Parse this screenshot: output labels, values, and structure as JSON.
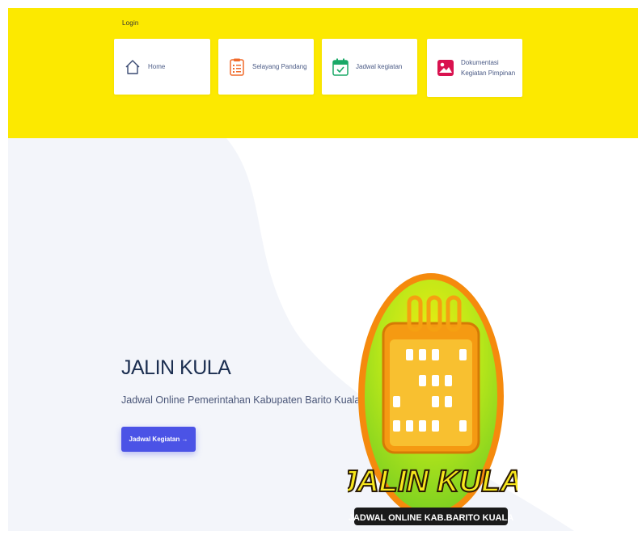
{
  "header": {
    "login_label": "Login",
    "nav": [
      {
        "label": "Home",
        "icon": "home-icon"
      },
      {
        "label": "Selayang Pandang",
        "icon": "clipboard-list-icon"
      },
      {
        "label": "Jadwal kegiatan",
        "icon": "calendar-check-icon"
      },
      {
        "label": "Dokumentasi Kegiatan Pimpinan",
        "icon": "image-icon"
      }
    ]
  },
  "hero": {
    "title": "JALIN KULA",
    "subtitle": "Jadwal Online Pemerintahan Kabupaten Barito Kuala",
    "cta_label": "Jadwal Kegiatan →"
  },
  "logo": {
    "main_text": "JALIN KULA",
    "sub_text": "JADWAL ONLINE KAB.BARITO KUALA"
  },
  "colors": {
    "header_bg": "#fce900",
    "hero_bg": "#f3f5fa",
    "cta_bg": "#4b53e6",
    "title": "#1b2e50"
  }
}
